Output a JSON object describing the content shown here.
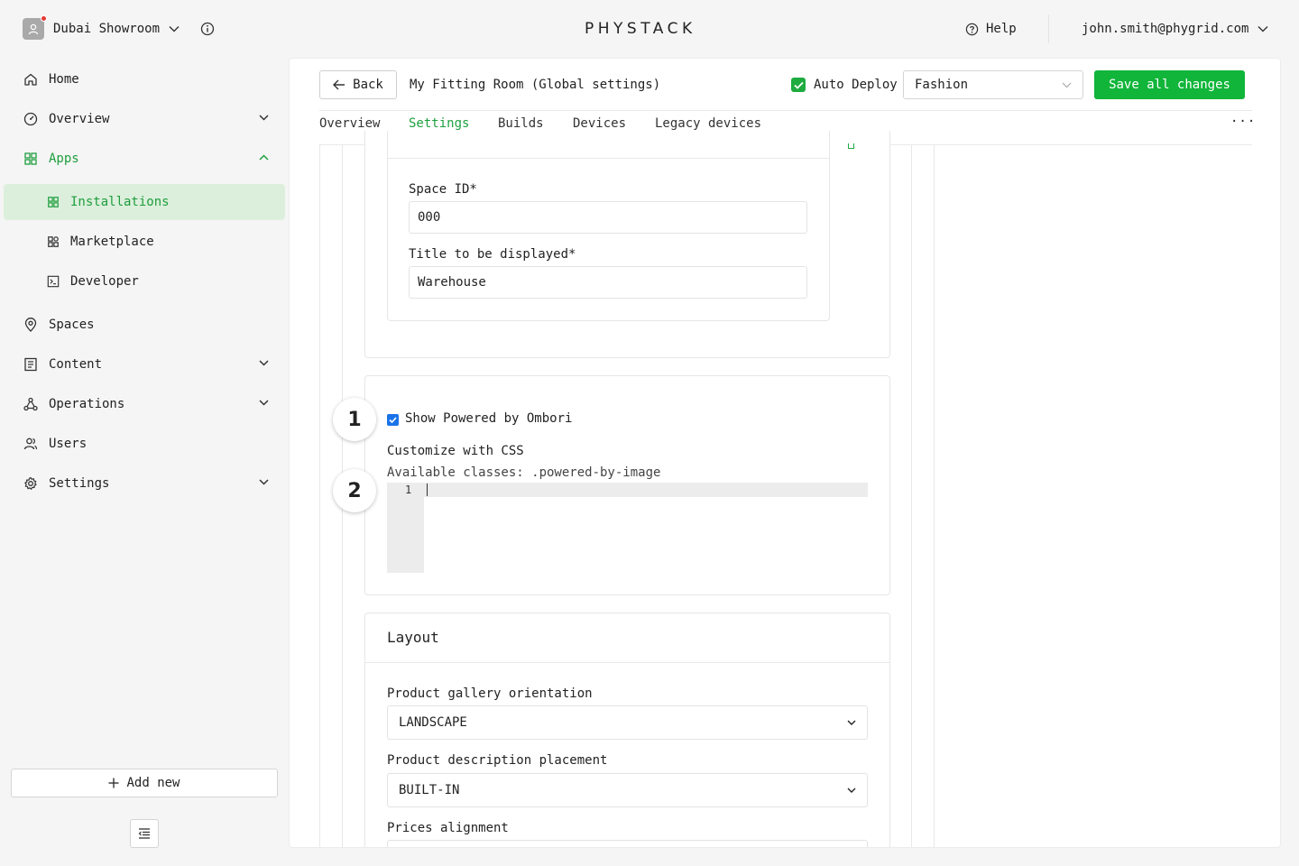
{
  "header": {
    "org_name": "Dubai Showroom",
    "logo": "PHYSTACK",
    "help": "Help",
    "user_email": "john.smith@phygrid.com"
  },
  "sidebar": {
    "items": [
      {
        "label": "Home",
        "icon": "home-icon"
      },
      {
        "label": "Overview",
        "icon": "dashboard-icon"
      },
      {
        "label": "Apps",
        "icon": "apps-icon"
      },
      {
        "label": "Installations",
        "icon": "installations-icon"
      },
      {
        "label": "Marketplace",
        "icon": "marketplace-icon"
      },
      {
        "label": "Developer",
        "icon": "terminal-icon"
      },
      {
        "label": "Spaces",
        "icon": "location-pin-icon"
      },
      {
        "label": "Content",
        "icon": "content-icon"
      },
      {
        "label": "Operations",
        "icon": "operations-icon"
      },
      {
        "label": "Users",
        "icon": "users-icon"
      },
      {
        "label": "Settings",
        "icon": "gear-icon"
      }
    ],
    "add_new": "Add new"
  },
  "toolbar": {
    "back": "Back",
    "title": "My Fitting Room (Global settings)",
    "auto_deploy": "Auto Deploy",
    "auto_deploy_checked": true,
    "selected_space": "Fashion",
    "save": "Save all changes"
  },
  "tabs": [
    "Overview",
    "Settings",
    "Builds",
    "Devices",
    "Legacy devices"
  ],
  "active_tab": "Settings",
  "form": {
    "space_id_label": "Space ID*",
    "space_id_value": "000",
    "title_label": "Title to be displayed*",
    "title_value": "Warehouse",
    "step1": "1",
    "step2": "2",
    "show_powered_label": "Show Powered by Ombori",
    "show_powered_checked": true,
    "css_label": "Customize with CSS",
    "css_classes": "Available classes: .powered-by-image",
    "editor_line": "1"
  },
  "layout_section": {
    "title": "Layout",
    "gallery_label": "Product gallery orientation",
    "gallery_value": "LANDSCAPE",
    "description_label": "Product description placement",
    "description_value": "BUILT-IN",
    "prices_label": "Prices alignment"
  },
  "colors": {
    "accent_green": "#10b53a",
    "active_bg": "#dcefdc",
    "checkbox_blue": "#1a73e8"
  }
}
